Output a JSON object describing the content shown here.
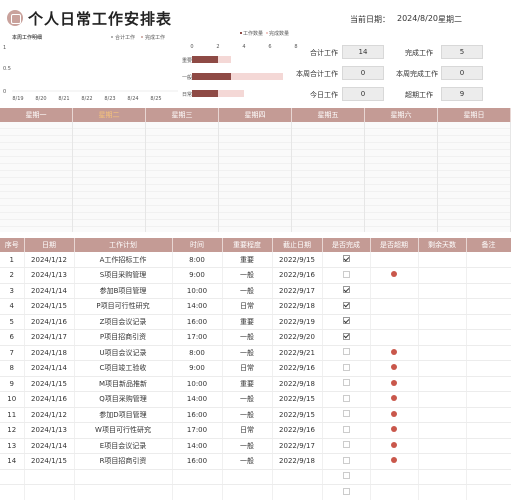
{
  "header": {
    "title": "个人日常工作安排表",
    "date_label": "当前日期：",
    "date_value": "2024/8/20",
    "weekday_value": "星期二"
  },
  "line_chart": {
    "title": "本周工作明细",
    "legend": [
      "合计工作",
      "完成工作"
    ],
    "y_ticks": [
      "1",
      "0.5",
      "0"
    ],
    "x_ticks": [
      "8/19",
      "8/20",
      "8/21",
      "8/22",
      "8/23",
      "8/24",
      "8/25"
    ]
  },
  "bar_chart": {
    "legend": [
      "工作数量",
      "完成数量"
    ],
    "x_ticks": [
      "0",
      "2",
      "4",
      "6",
      "8"
    ],
    "categories": [
      "重要",
      "一般",
      "日常"
    ],
    "values_total": [
      3,
      7,
      4
    ],
    "values_done": [
      2,
      3,
      2
    ]
  },
  "stats": {
    "total_label": "合计工作",
    "total_value": "14",
    "done_label": "完成工作",
    "done_value": "5",
    "week_total_label": "本周合计工作",
    "week_total_value": "0",
    "week_done_label": "本周完成工作",
    "week_done_value": "0",
    "today_label": "今日工作",
    "today_value": "0",
    "overdue_label": "超期工作",
    "overdue_value": "9"
  },
  "weekdays": [
    "星期一",
    "星期二",
    "星期三",
    "星期四",
    "星期五",
    "星期六",
    "星期日"
  ],
  "table": {
    "headers": [
      "序号",
      "日期",
      "工作计划",
      "时间",
      "重要程度",
      "截止日期",
      "是否完成",
      "是否超期",
      "剩余天数",
      "备注"
    ],
    "rows": [
      {
        "no": "1",
        "date": "2024/1/12",
        "plan": "A工作招标工作",
        "time": "8:00",
        "level": "重要",
        "deadline": "2022/9/15",
        "done": true,
        "overdue": false
      },
      {
        "no": "2",
        "date": "2024/1/13",
        "plan": "S项目采购管理",
        "time": "9:00",
        "level": "一般",
        "deadline": "2022/9/16",
        "done": false,
        "overdue": true
      },
      {
        "no": "3",
        "date": "2024/1/14",
        "plan": "参加B项目管理",
        "time": "10:00",
        "level": "一般",
        "deadline": "2022/9/17",
        "done": true,
        "overdue": false
      },
      {
        "no": "4",
        "date": "2024/1/15",
        "plan": "P项目可行性研究",
        "time": "14:00",
        "level": "日常",
        "deadline": "2022/9/18",
        "done": true,
        "overdue": false
      },
      {
        "no": "5",
        "date": "2024/1/16",
        "plan": "Z项目会议记录",
        "time": "16:00",
        "level": "重要",
        "deadline": "2022/9/19",
        "done": true,
        "overdue": false
      },
      {
        "no": "6",
        "date": "2024/1/17",
        "plan": "P项目招商引资",
        "time": "17:00",
        "level": "一般",
        "deadline": "2022/9/20",
        "done": true,
        "overdue": false
      },
      {
        "no": "7",
        "date": "2024/1/18",
        "plan": "U项目会议记录",
        "time": "8:00",
        "level": "一般",
        "deadline": "2022/9/21",
        "done": false,
        "overdue": true
      },
      {
        "no": "8",
        "date": "2024/1/14",
        "plan": "C项目竣工验收",
        "time": "9:00",
        "level": "日常",
        "deadline": "2022/9/16",
        "done": false,
        "overdue": true
      },
      {
        "no": "9",
        "date": "2024/1/15",
        "plan": "M项目新品推新",
        "time": "10:00",
        "level": "重要",
        "deadline": "2022/9/18",
        "done": false,
        "overdue": true
      },
      {
        "no": "10",
        "date": "2024/1/16",
        "plan": "Q项目采购管理",
        "time": "14:00",
        "level": "一般",
        "deadline": "2022/9/15",
        "done": false,
        "overdue": true
      },
      {
        "no": "11",
        "date": "2024/1/12",
        "plan": "参加D项目管理",
        "time": "16:00",
        "level": "一般",
        "deadline": "2022/9/15",
        "done": false,
        "overdue": true
      },
      {
        "no": "12",
        "date": "2024/1/13",
        "plan": "W项目可行性研究",
        "time": "17:00",
        "level": "日常",
        "deadline": "2022/9/16",
        "done": false,
        "overdue": true
      },
      {
        "no": "13",
        "date": "2024/1/14",
        "plan": "E项目会议记录",
        "time": "14:00",
        "level": "一般",
        "deadline": "2022/9/17",
        "done": false,
        "overdue": true
      },
      {
        "no": "14",
        "date": "2024/1/15",
        "plan": "R项目招商引资",
        "time": "16:00",
        "level": "一般",
        "deadline": "2022/9/18",
        "done": false,
        "overdue": true
      }
    ],
    "empty_rows": 2
  },
  "colors": {
    "header_bg": "#c49b95",
    "bar_total": "#8e4a45",
    "bar_done": "#f0c8c4",
    "overdue_dot": "#c0392b"
  },
  "icons": {
    "logo": "calendar-icon"
  }
}
